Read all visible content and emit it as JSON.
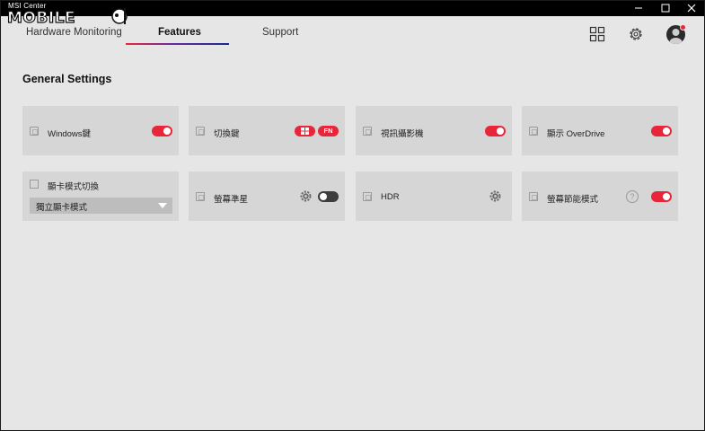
{
  "window": {
    "app_title": "MSI Center",
    "logo_text": "MOBILE01",
    "minimize_glyph": "—",
    "close_glyph": "✕"
  },
  "tabs": [
    {
      "label": "Hardware Monitoring",
      "active": false
    },
    {
      "label": "Features",
      "active": true
    },
    {
      "label": "Support",
      "active": false
    }
  ],
  "header_icons": [
    "grid-icon",
    "settings-gear-icon",
    "avatar"
  ],
  "section": {
    "title": "General Settings"
  },
  "cards": [
    {
      "label": "Windows鍵",
      "icon": "windows-key-icon",
      "control": "toggle",
      "on": true
    },
    {
      "label": "切換鍵",
      "icon": "switch-key-icon",
      "control": "pills",
      "pills": [
        "",
        "FN"
      ]
    },
    {
      "label": "視訊攝影機",
      "icon": "webcam-icon",
      "control": "toggle",
      "on": true
    },
    {
      "label": "顯示 OverDrive",
      "icon": "overdrive-icon",
      "control": "toggle",
      "on": true
    },
    {
      "label": "顯卡模式切換",
      "icon": "gpu-switch-icon",
      "control": "select",
      "selected": "獨立顯卡模式"
    },
    {
      "label": "螢幕準星",
      "icon": "crosshair-icon",
      "control": "gear+toggle",
      "on": false
    },
    {
      "label": "HDR",
      "icon": "hdr-icon",
      "control": "gear"
    },
    {
      "label": "螢幕節能模式",
      "icon": "eco-display-icon",
      "control": "help+toggle",
      "help_glyph": "?",
      "on": true
    }
  ],
  "colors": {
    "accent": "#e8263a",
    "card_bg": "#d6d6d6",
    "page_bg": "#e6e6e6",
    "titlebar": "#000000",
    "toggle_off": "#3d3d3d"
  }
}
